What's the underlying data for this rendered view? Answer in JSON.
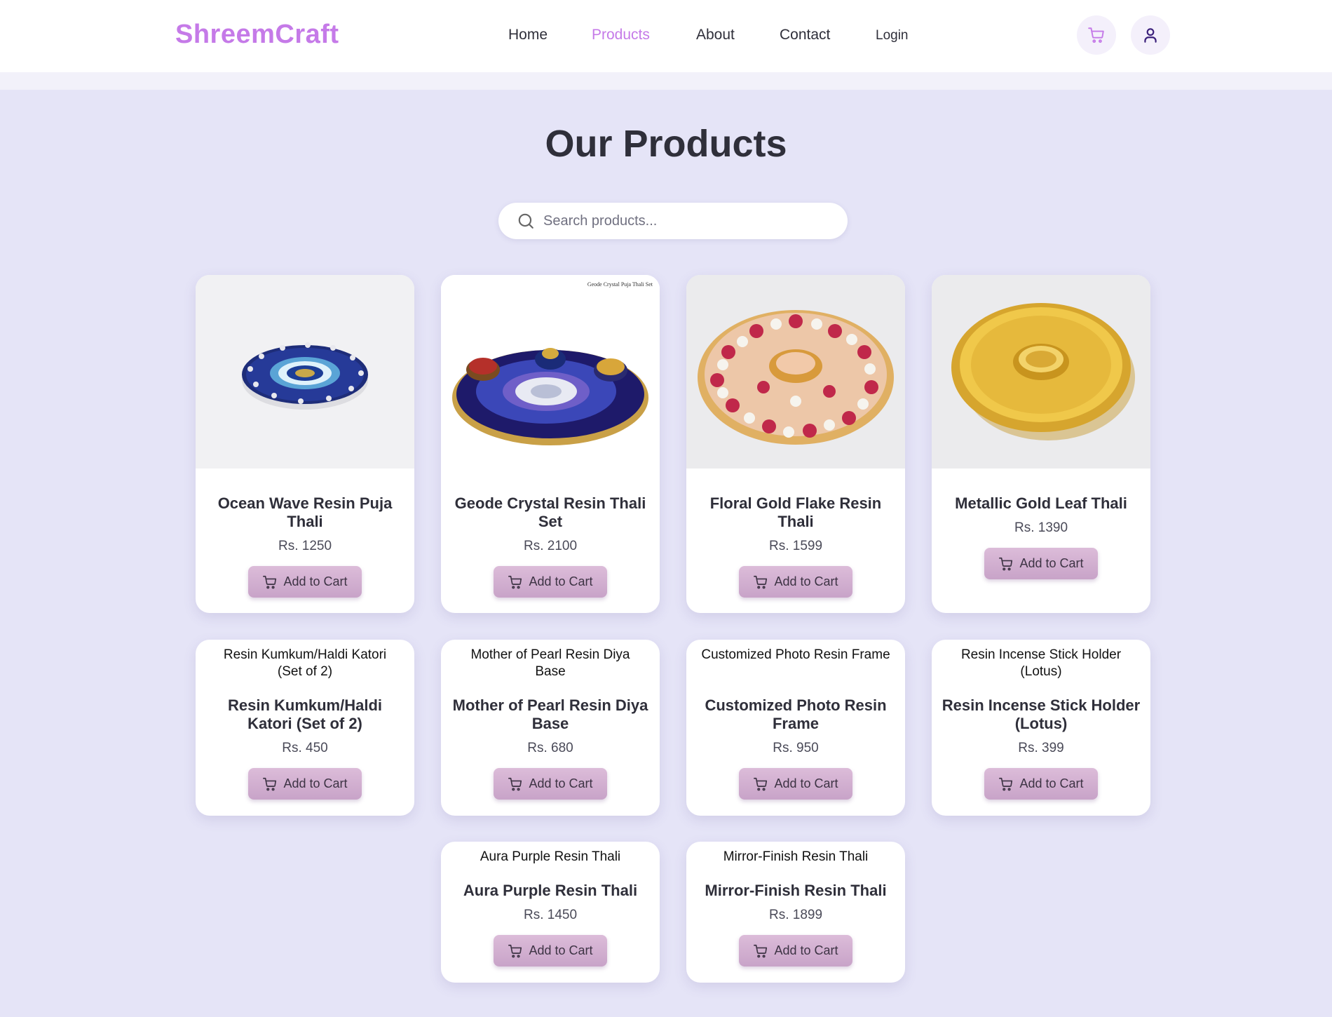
{
  "brand": "ShreemCraft",
  "nav": [
    {
      "label": "Home"
    },
    {
      "label": "Products"
    },
    {
      "label": "About"
    },
    {
      "label": "Contact"
    },
    {
      "label": "Login"
    }
  ],
  "header_icons": [
    "cart-icon",
    "user-icon"
  ],
  "page_title": "Our Products",
  "search": {
    "placeholder": "Search products...",
    "value": ""
  },
  "add_to_cart_label": "Add to Cart",
  "colors": {
    "accent": "#c57ae8",
    "background": "#e5e4f7",
    "button": "#d3b1d2",
    "user_icon": "#3a1f7a"
  },
  "products": [
    {
      "name": "Ocean Wave Resin Puja Thali",
      "price": "Rs. 1250",
      "image_state": "loaded"
    },
    {
      "name": "Geode Crystal Resin Thali Set",
      "price": "Rs. 2100",
      "image_state": "loaded",
      "image_caption": "Geode Crystal Puja Thali Set"
    },
    {
      "name": "Floral Gold Flake Resin Thali",
      "price": "Rs. 1599",
      "image_state": "loaded"
    },
    {
      "name": "Metallic Gold Leaf Thali",
      "price": "Rs. 1390",
      "image_state": "loaded"
    },
    {
      "name": "Resin Kumkum/Haldi Katori (Set of 2)",
      "price": "Rs. 450",
      "image_state": "broken",
      "alt": "Resin Kumkum/Haldi Katori (Set of 2)"
    },
    {
      "name": "Mother of Pearl Resin Diya Base",
      "price": "Rs. 680",
      "image_state": "broken",
      "alt": "Mother of Pearl Resin Diya Base"
    },
    {
      "name": "Customized Photo Resin Frame",
      "price": "Rs. 950",
      "image_state": "broken",
      "alt": "Customized Photo Resin Frame"
    },
    {
      "name": "Resin Incense Stick Holder (Lotus)",
      "price": "Rs. 399",
      "image_state": "broken",
      "alt": "Resin Incense Stick Holder (Lotus)"
    },
    {
      "name": "Aura Purple Resin Thali",
      "price": "Rs. 1450",
      "image_state": "broken",
      "alt": "Aura Purple Resin Thali"
    },
    {
      "name": "Mirror-Finish Resin Thali",
      "price": "Rs. 1899",
      "image_state": "broken",
      "alt": "Mirror-Finish Resin Thali"
    }
  ]
}
